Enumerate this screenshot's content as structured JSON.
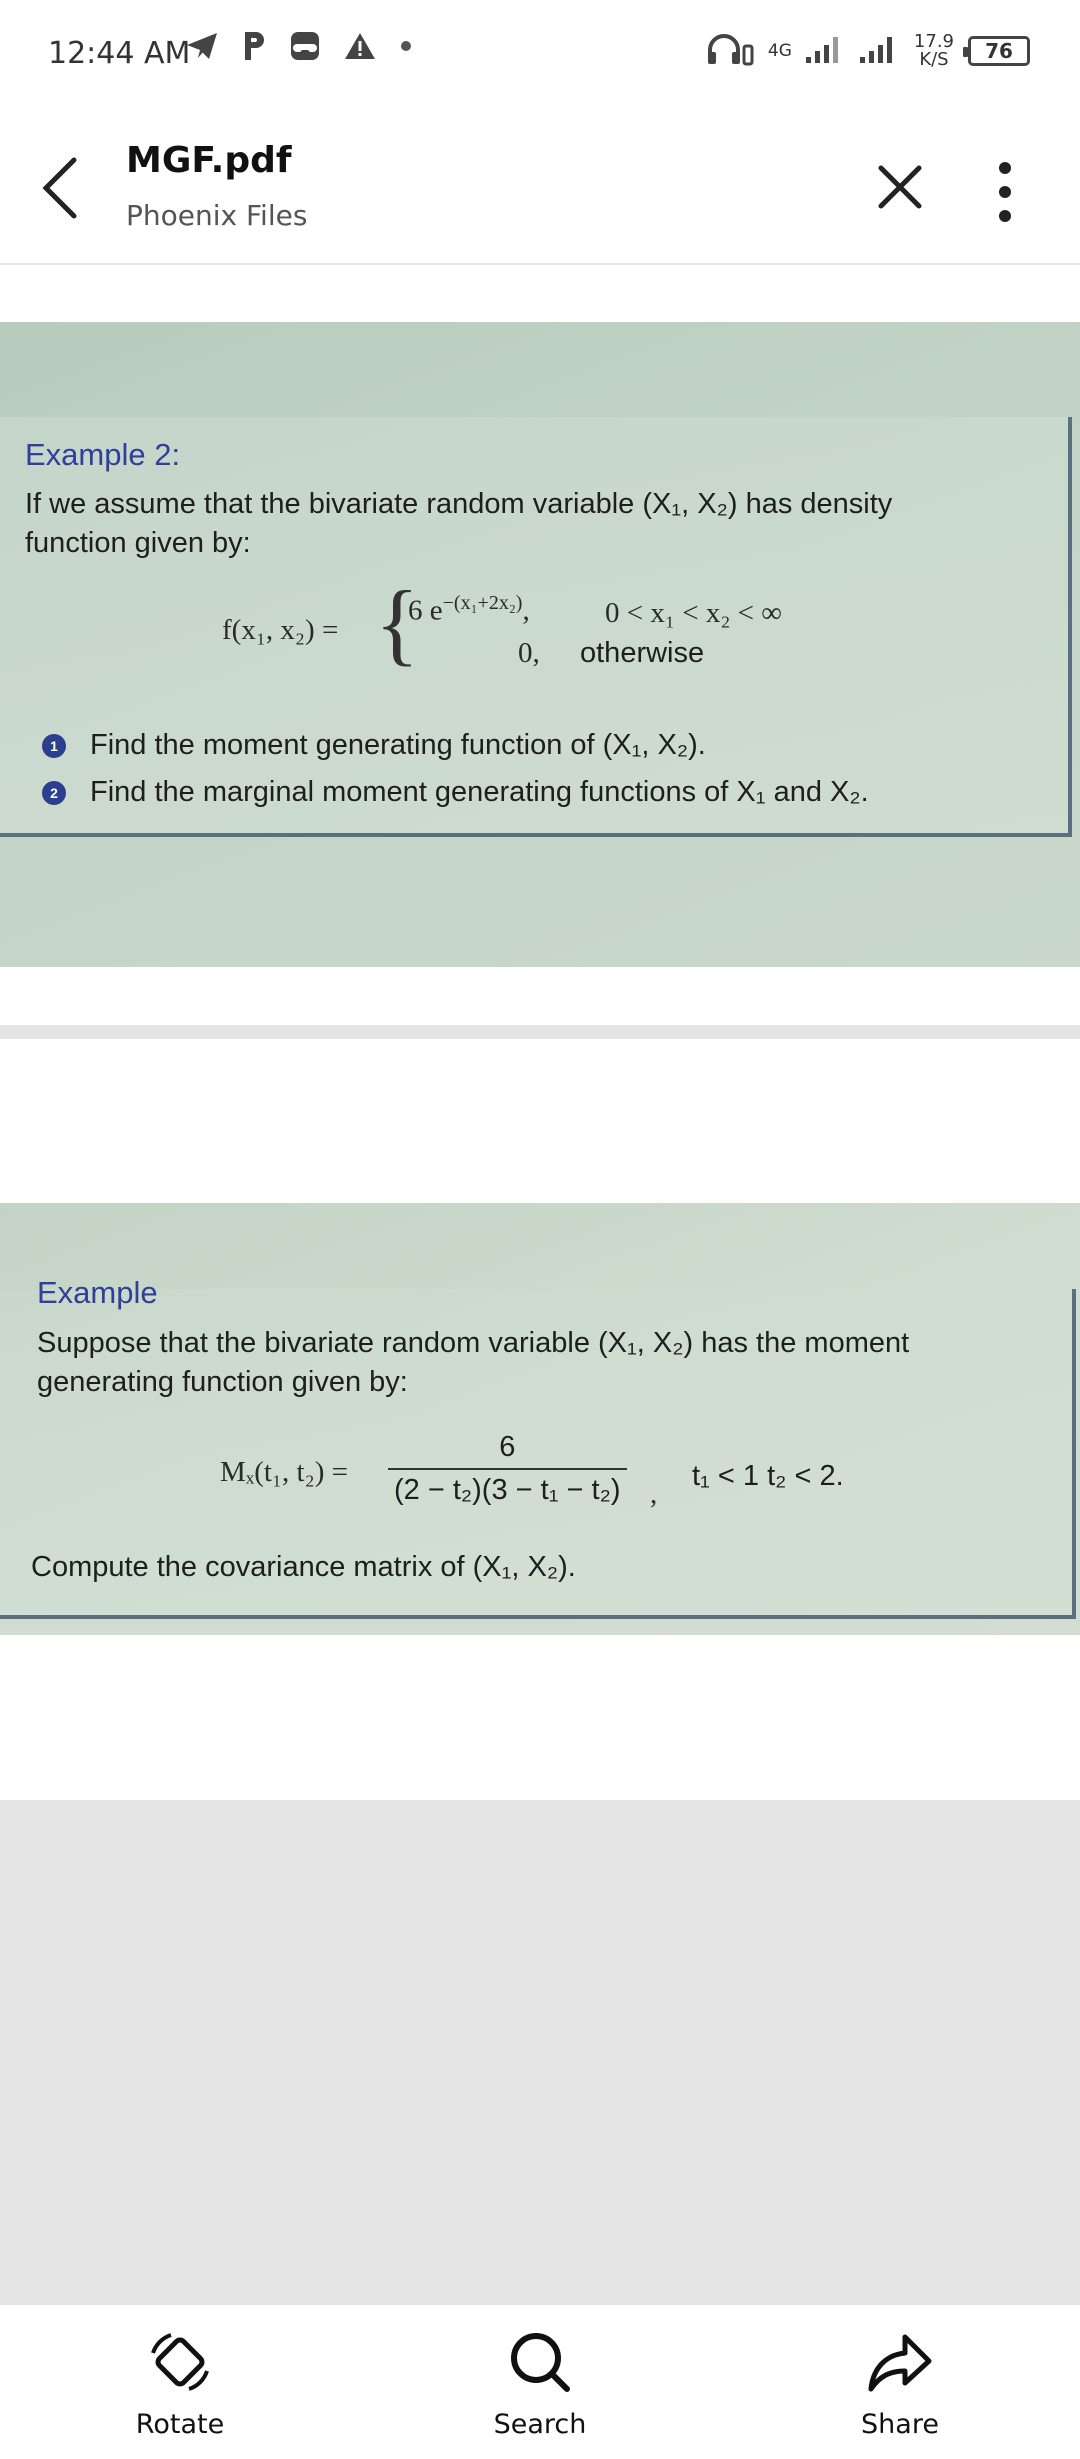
{
  "status_bar": {
    "time": "12:44 AM",
    "network_type": "4G",
    "net_speed_value": "17.9",
    "net_speed_unit": "K/S",
    "battery": "76"
  },
  "app_bar": {
    "title": "MGF.pdf",
    "subtitle": "Phoenix Files"
  },
  "page1": {
    "example_title": "Example 2:",
    "intro_line1": "If we assume that the bivariate random variable (X₁, X₂) has density",
    "intro_line2": "function given by:",
    "func_lhs": "f(x₁, x₂) =",
    "case1_expr": "6 e",
    "case1_exp": "−(x₁+2x₂)",
    "case1_comma": ",",
    "case1_cond": "0 < x₁ < x₂ < ∞",
    "case2_expr": "0,",
    "case2_cond": "otherwise",
    "items": [
      {
        "num": "1",
        "text": "Find the moment generating function of (X₁, X₂)."
      },
      {
        "num": "2",
        "text": "Find the marginal moment generating functions of X₁ and X₂."
      }
    ]
  },
  "page2": {
    "example_title": "Example",
    "intro_line1": "Suppose that the bivariate random variable (X₁, X₂) has the moment",
    "intro_line2": "generating function given by:",
    "mgf_lhs": "Mₓ(t₁, t₂) =",
    "mgf_num": "6",
    "mgf_den": "(2 − t₂)(3 − t₁ − t₂)",
    "mgf_cond": "t₁ < 1 t₂ < 2.",
    "conclusion": "Compute the covariance matrix of (X₁, X₂)."
  },
  "bottom_nav": {
    "rotate": "Rotate",
    "search": "Search",
    "share": "Share"
  }
}
